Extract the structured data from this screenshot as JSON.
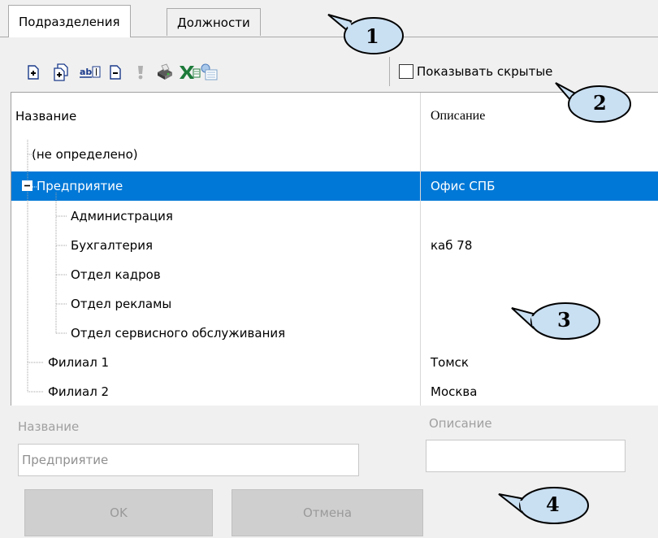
{
  "tabs": [
    {
      "label": "Подразделения",
      "active": true
    },
    {
      "label": "Должности",
      "active": false
    }
  ],
  "toolbar": {
    "icons": [
      "add-item-icon",
      "add-subitem-icon",
      "rename-icon",
      "delete-icon",
      "info-icon",
      "print-icon",
      "excel-export-icon",
      "import-icon"
    ],
    "show_hidden_label": "Показывать скрытые",
    "show_hidden_checked": false
  },
  "grid": {
    "columns": [
      "Название",
      "Описание"
    ],
    "rows": [
      {
        "name": "(не определено)",
        "desc": "",
        "level": 0,
        "selected": false
      },
      {
        "name": "Предприятие",
        "desc": "Офис СПБ",
        "level": 0,
        "selected": true,
        "expanded": true
      },
      {
        "name": "Администрация",
        "desc": "",
        "level": 1,
        "selected": false
      },
      {
        "name": "Бухгалтерия",
        "desc": "каб 78",
        "level": 1,
        "selected": false
      },
      {
        "name": "Отдел кадров",
        "desc": "",
        "level": 1,
        "selected": false
      },
      {
        "name": "Отдел рекламы",
        "desc": "",
        "level": 1,
        "selected": false
      },
      {
        "name": "Отдел сервисного обслуживания",
        "desc": "",
        "level": 1,
        "selected": false
      },
      {
        "name": "Филиал 1",
        "desc": "Томск",
        "level": 0,
        "selected": false
      },
      {
        "name": "Филиал 2",
        "desc": "Москва",
        "level": 0,
        "selected": false
      }
    ]
  },
  "form": {
    "name_label": "Название",
    "name_value": "Предприятие",
    "desc_label": "Описание",
    "desc_value": "",
    "ok_label": "OK",
    "cancel_label": "Отмена"
  },
  "callouts": [
    "1",
    "2",
    "3",
    "4"
  ],
  "colors": {
    "selection": "#0078d7",
    "callout_fill": "#c9dff2",
    "window_bg": "#f0f0f0"
  }
}
